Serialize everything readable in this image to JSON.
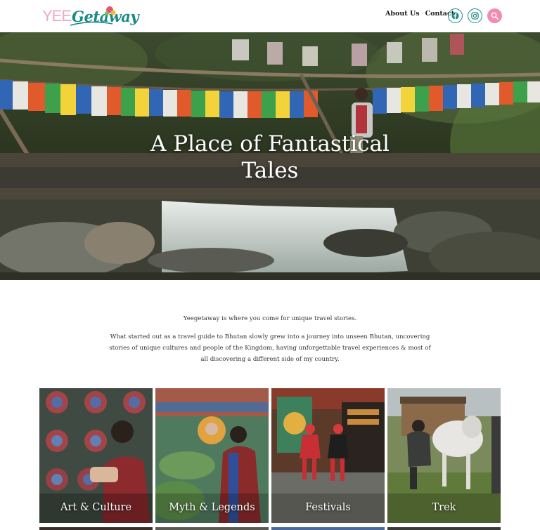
{
  "header": {
    "logo": {
      "part1": "YEE",
      "part2": "Getaway"
    },
    "nav": [
      {
        "label": "About Us"
      },
      {
        "label": "Contact"
      }
    ],
    "social": [
      {
        "icon": "facebook-icon"
      },
      {
        "icon": "instagram-icon"
      }
    ],
    "search_icon": "search-icon"
  },
  "hero": {
    "title_line1": "A Place of Fantastical",
    "title_line2": "Tales"
  },
  "intro": {
    "lead": "Yeegetaway is where you come for unique travel stories.",
    "body": "What started out as a travel guide to Bhutan slowly grew into a journey into unseen Bhutan, uncovering stories of unique cultures and people of the Kingdom, having unforgettable travel experiences & most of all discovering a different side of my country."
  },
  "categories": [
    {
      "label": "Art & Culture"
    },
    {
      "label": "Myth & Legends"
    },
    {
      "label": "Festivals"
    },
    {
      "label": "Trek"
    }
  ],
  "colors": {
    "accent_teal": "#1a8a86",
    "accent_pink": "#f28cb3"
  }
}
